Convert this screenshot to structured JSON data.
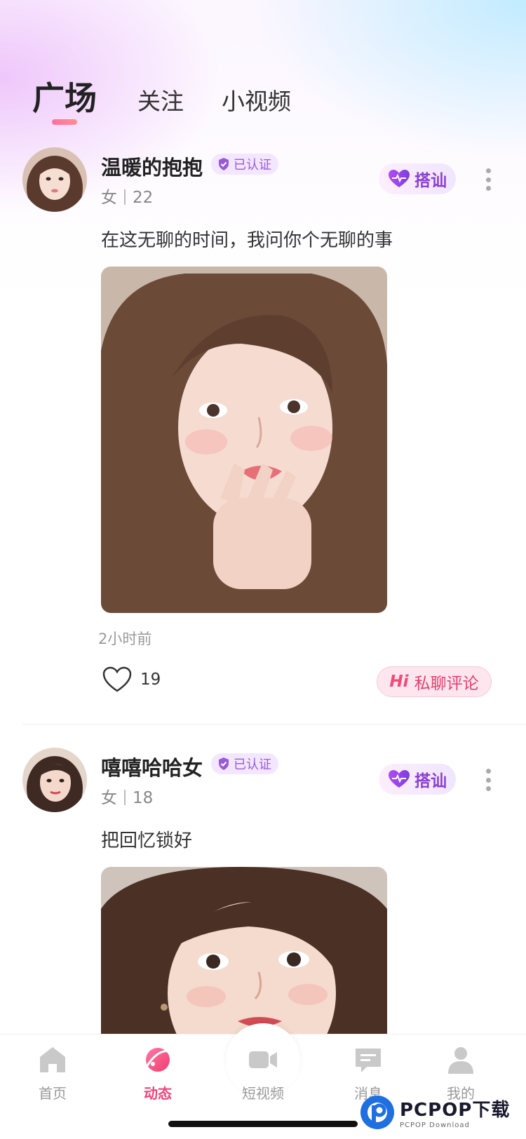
{
  "tabs": {
    "active": "广场",
    "follow": "关注",
    "short_video": "小视频"
  },
  "posts": [
    {
      "username": "温暖的抱抱",
      "verified_label": "已认证",
      "gender": "女",
      "age": "22",
      "greet_label": "搭讪",
      "text": "在这无聊的时间，我问你个无聊的事",
      "time": "2小时前",
      "likes": "19",
      "private_comment_hi": "Hi",
      "private_comment_label": "私聊评论"
    },
    {
      "username": "嘻嘻哈哈女",
      "verified_label": "已认证",
      "gender": "女",
      "age": "18",
      "greet_label": "搭讪",
      "text": "把回忆锁好"
    }
  ],
  "tabbar": {
    "items": [
      {
        "label": "首页",
        "icon": "home-icon"
      },
      {
        "label": "动态",
        "icon": "planet-icon"
      },
      {
        "label": "短视频",
        "icon": "video-camera-icon"
      },
      {
        "label": "消息",
        "icon": "message-icon"
      },
      {
        "label": "我的",
        "icon": "profile-icon"
      }
    ],
    "active_index": 1
  },
  "watermark": {
    "brand": "PCPOP下载",
    "sub": "PCPOP Download"
  },
  "colors": {
    "accent_pink": "#f0457a",
    "greet_purple": "#8a3fd0",
    "verified_purple": "#9a5ad8"
  }
}
